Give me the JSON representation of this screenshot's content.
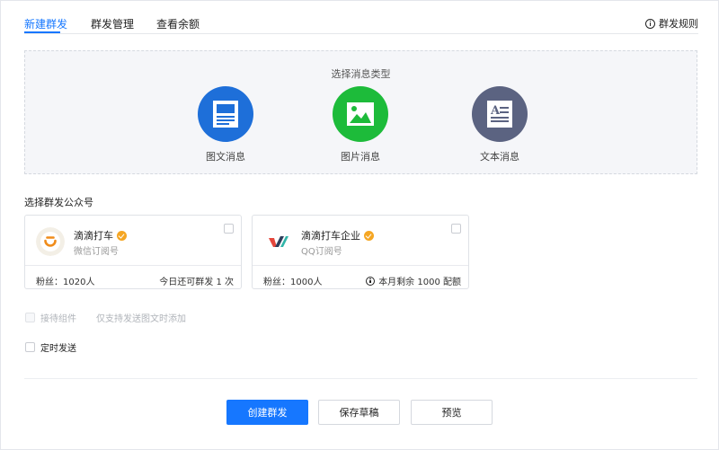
{
  "tabs": [
    {
      "label": "新建群发",
      "active": true
    },
    {
      "label": "群发管理",
      "active": false
    },
    {
      "label": "查看余额",
      "active": false
    }
  ],
  "rules_label": "群发规则",
  "message_type": {
    "title": "选择消息类型",
    "items": [
      {
        "label": "图文消息",
        "icon": "article-icon",
        "color": "#1e6fd9"
      },
      {
        "label": "图片消息",
        "icon": "image-icon",
        "color": "#1dbb3a"
      },
      {
        "label": "文本消息",
        "icon": "text-icon",
        "color": "#5b6381"
      }
    ]
  },
  "accounts_section": {
    "title": "选择群发公众号",
    "cards": [
      {
        "name": "滴滴打车",
        "type": "微信订阅号",
        "fans": "粉丝：1020人",
        "quota": "今日还可群发 1 次",
        "verified": true,
        "checked": false
      },
      {
        "name": "滴滴打车企业",
        "type": "QQ订阅号",
        "fans": "粉丝：1000人",
        "quota": "本月剩余 1000 配额",
        "verified": true,
        "checked": false
      }
    ]
  },
  "options": {
    "reception_label": "接待组件",
    "reception_hint": "仅支持发送图文时添加",
    "scheduled_label": "定时发送"
  },
  "buttons": {
    "create": "创建群发",
    "save_draft": "保存草稿",
    "preview": "预览"
  },
  "colors": {
    "accent": "#1677ff",
    "verified": "#f5a623"
  }
}
